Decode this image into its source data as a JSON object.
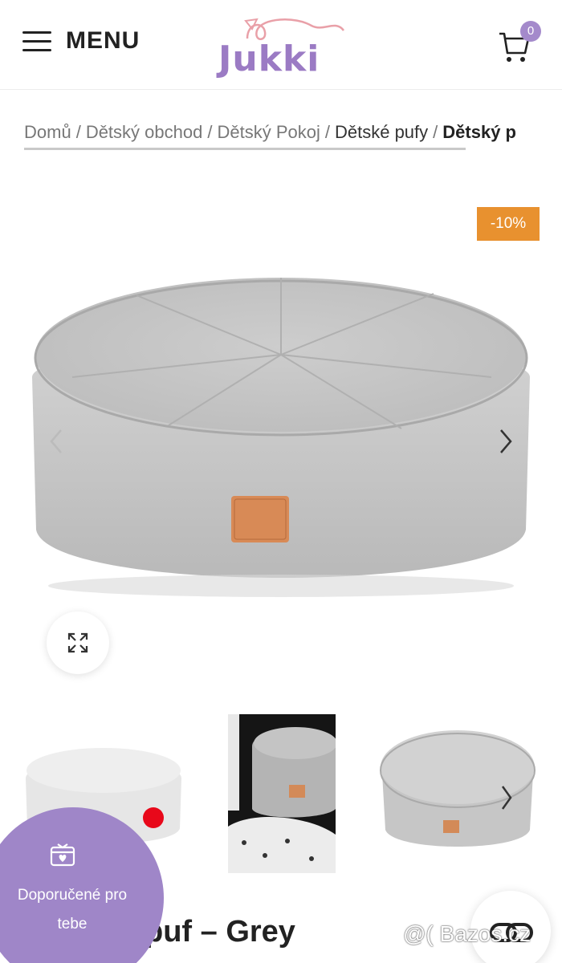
{
  "header": {
    "menu_label": "MENU",
    "logo_text": "Jukki",
    "cart_count": "0"
  },
  "breadcrumb": {
    "items": [
      "Domů",
      "Dětský obchod",
      "Dětský Pokoj",
      "Dětské pufy"
    ],
    "current": "Dětský p",
    "separator": "/"
  },
  "product": {
    "discount_badge": "-10%",
    "title_fragment": "puf – Grey"
  },
  "recommended": {
    "label_line1": "Doporučené pro",
    "label_line2": "tebe"
  },
  "watermark": "@( Bazos.cz",
  "colors": {
    "brand_purple": "#9b7bc4",
    "discount_orange": "#e8912f",
    "pouf_grey": "#c9c9c9",
    "red_dot": "#e8081a"
  },
  "icons": [
    "menu-icon",
    "cart-icon",
    "chevron-left-icon",
    "chevron-right-icon",
    "expand-icon",
    "gift-box-icon",
    "compare-icon"
  ]
}
